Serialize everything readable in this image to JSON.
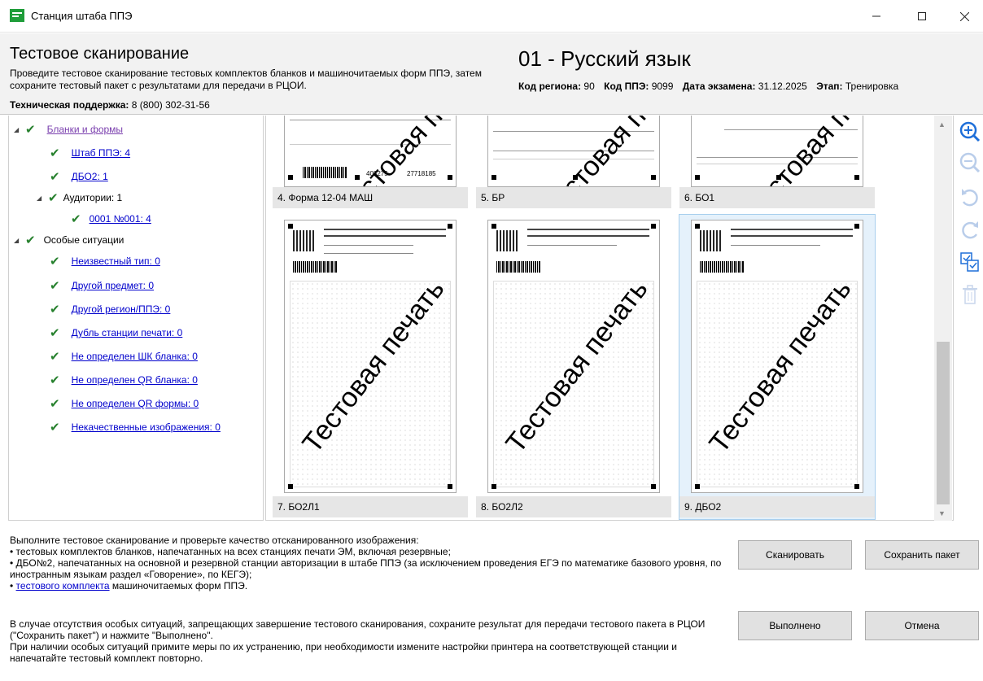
{
  "window": {
    "title": "Станция штаба ППЭ",
    "min_icon": "minimize-icon",
    "max_icon": "maximize-icon",
    "close_icon": "close-icon"
  },
  "header": {
    "title": "Тестовое сканирование",
    "description": "Проведите тестовое сканирование тестовых комплектов бланков и машиночитаемых форм ППЭ, затем сохраните тестовый пакет с результатами для передачи в РЦОИ.",
    "support_label": "Техническая поддержка:",
    "support_value": "8 (800) 302-31-56",
    "subject": "01 - Русский язык",
    "region_label": "Код региона:",
    "region_value": "90",
    "ppe_label": "Код ППЭ:",
    "ppe_value": "9099",
    "date_label": "Дата экзамена:",
    "date_value": "31.12.2025",
    "stage_label": "Этап:",
    "stage_value": "Тренировка"
  },
  "tree": {
    "forms": "Бланки и формы",
    "staff": "Штаб ППЭ: 4",
    "dbo2": "ДБО2: 1",
    "auditoriums": "Аудитории: 1",
    "aud_0001": "0001 №001: 4",
    "special": "Особые ситуации",
    "special_items": [
      "Неизвестный тип: 0",
      "Другой предмет: 0",
      "Другой регион/ППЭ: 0",
      "Дубль станции печати: 0",
      "Не определен ШК бланка: 0",
      "Не определен QR бланка: 0",
      "Не определен QR формы: 0",
      "Некачественные изображения: 0"
    ]
  },
  "gallery": {
    "watermark": "Тестовая печать",
    "row1_numbers": [
      "408275",
      "27718185"
    ],
    "thumbs": [
      {
        "caption": "4. Форма 12-04 МАШ"
      },
      {
        "caption": "5. БР"
      },
      {
        "caption": "6. БО1"
      },
      {
        "caption": "7. БО2Л1"
      },
      {
        "caption": "8. БО2Л2"
      },
      {
        "caption": "9. ДБО2"
      }
    ]
  },
  "tools": [
    "zoom-in-icon",
    "zoom-out-icon",
    "rotate-left-icon",
    "rotate-right-icon",
    "select-all-icon",
    "delete-icon"
  ],
  "instructions": {
    "intro": "Выполните тестовое сканирование и проверьте качество отсканированного изображения:",
    "bullet1": "• тестовых комплектов бланков, напечатанных на всех станциях печати ЭМ, включая резервные;",
    "bullet2": "• ДБО№2, напечатанных на основной и резервной станции авторизации в штабе ППЭ (за исключением проведения ЕГЭ по математике базового уровня, по иностранным языкам раздел «Говорение», по КЕГЭ);",
    "bullet3_prefix": "• ",
    "bullet3_link": "тестового комплекта",
    "bullet3_suffix": " машиночитаемых форм ППЭ.",
    "para2": "В случае отсутствия особых ситуаций, запрещающих завершение тестового сканирования, сохраните результат для передачи тестового пакета в РЦОИ (\"Сохранить пакет\") и нажмите \"Выполнено\".",
    "para3": "При наличии особых ситуаций примите меры по их устранению, при необходимости измените настройки принтера на соответствующей станции и напечатайте тестовый комплект повторно."
  },
  "buttons": {
    "scan": "Сканировать",
    "save": "Сохранить пакет",
    "done": "Выполнено",
    "cancel": "Отмена"
  },
  "colors": {
    "check": "#27812e",
    "link": "#0000cc",
    "zoom_in": "#1e6fd9"
  }
}
